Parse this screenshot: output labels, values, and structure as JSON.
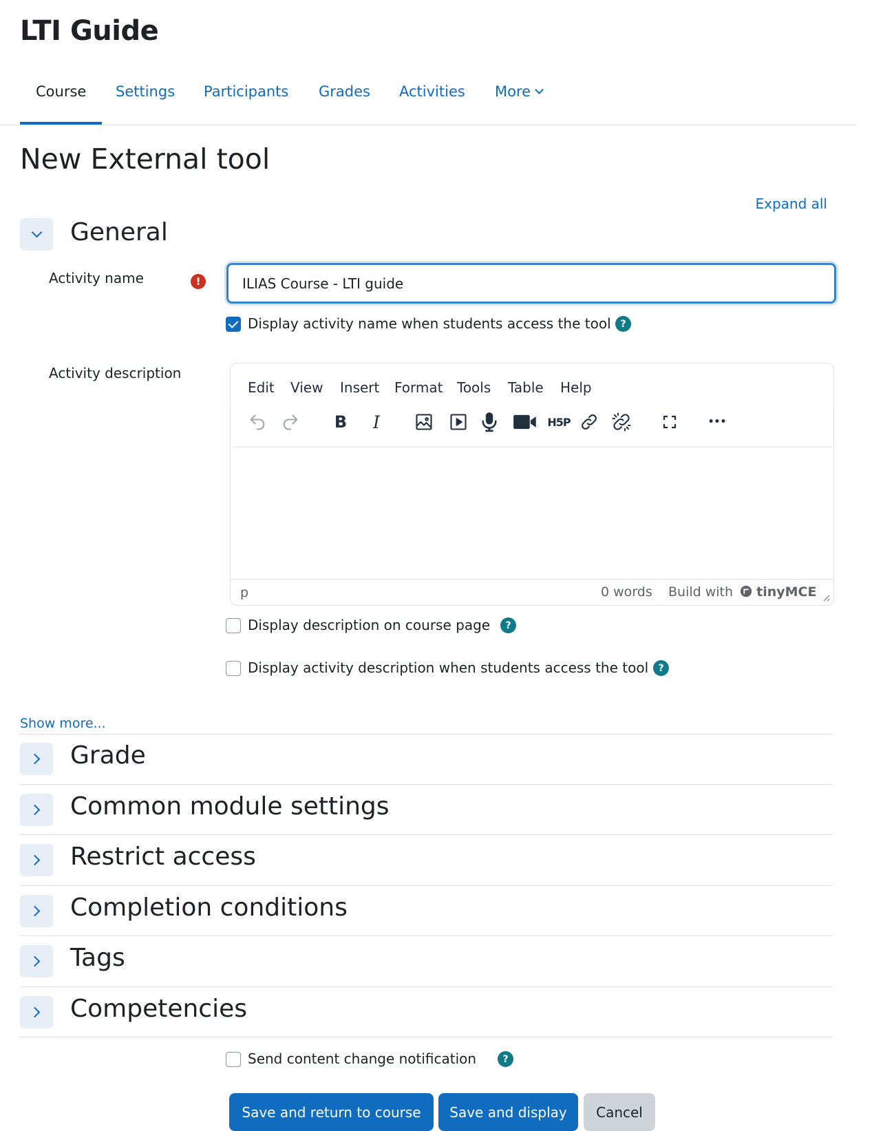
{
  "course": {
    "title": "LTI Guide"
  },
  "tabs": [
    "Course",
    "Settings",
    "Participants",
    "Grades",
    "Activities",
    "More"
  ],
  "page": {
    "title": "New External tool",
    "expand_all": "Expand all"
  },
  "general": {
    "title": "General",
    "activity_name_label": "Activity name",
    "required_icon": "!",
    "activity_name_value": "ILIAS Course - LTI guide",
    "display_name_checkbox": {
      "label": "Display activity name when students access the tool",
      "checked": true
    },
    "activity_description_label": "Activity description",
    "editor": {
      "menu": [
        "Edit",
        "View",
        "Insert",
        "Format",
        "Tools",
        "Table",
        "Help"
      ],
      "tools": [
        "undo-icon",
        "redo-icon",
        "bold-icon",
        "italic-icon",
        "image-icon",
        "media-icon",
        "microphone-icon",
        "video-camera-icon",
        "h5p-icon",
        "link-icon",
        "unlink-icon",
        "fullscreen-icon",
        "more-icon"
      ],
      "bold_glyph": "B",
      "italic_glyph": "I",
      "h5p_glyph": "H5P",
      "more_glyph": "•••",
      "status_path": "p",
      "word_count": "0 words",
      "brand_prefix": "Build with",
      "brand_name": "tinyMCE"
    },
    "display_description_checkbox": {
      "label": "Display description on course page",
      "checked": false
    },
    "display_activity_description_checkbox": {
      "label": "Display activity description when students access the tool",
      "checked": false
    },
    "help_icon": "?",
    "show_more": "Show more..."
  },
  "sections": [
    "Grade",
    "Common module settings",
    "Restrict access",
    "Completion conditions",
    "Tags",
    "Competencies"
  ],
  "notification": {
    "label": "Send content change notification",
    "checked": false
  },
  "buttons": {
    "save_return": "Save and return to course",
    "save_display": "Save and display",
    "cancel": "Cancel"
  },
  "colors": {
    "primary": "#0f6cbf",
    "help": "#0f7b88",
    "required": "#ca3120",
    "toggle_bg": "#e7eef7"
  }
}
